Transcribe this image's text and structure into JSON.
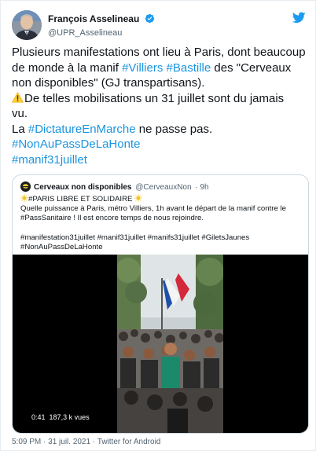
{
  "author": {
    "display_name": "François Asselineau",
    "handle": "@UPR_Asselineau"
  },
  "tweet": {
    "line1": "Plusieurs manifestations ont lieu à Paris, dont beaucoup",
    "line2_pre": "de monde à la manif ",
    "tag_villiers": "#Villiers",
    "tag_bastille": "#Bastille",
    "line2_post": " des \"Cerveaux",
    "line3": "non disponibles\" (GJ transpartisans).",
    "line4": "De telles mobilisations un 31 juillet sont du jamais",
    "line5": "vu.",
    "line6_pre": "La ",
    "tag_dictature": "#DictatureEnMarche",
    "line6_post": " ne passe pas.",
    "tag_nonaupass": "#NonAuPassDeLaHonte",
    "tag_manif": "#manif31juillet"
  },
  "quote": {
    "name": "Cerveaux non disponibles",
    "handle": "@CerveauxNon",
    "time": "· 9h",
    "title": "#PARIS LIBRE ET SOLIDAIRE",
    "line2": "Quelle puissance à Paris, métro Villiers, 1h avant le départ de la manif contre le",
    "line3": "#PassSanitaire ! Il est encore temps de nous rejoindre.",
    "line5": "#manifestation31juillet #manif31juillet #manifs31juillet #GiletsJaunes",
    "line6": "#NonAuPassDeLaHonte",
    "video_duration": "0:41",
    "video_views": "187,3 k vues"
  },
  "footer": {
    "text": "5:09 PM · 31 juil. 2021 · Twitter for Android"
  },
  "colors": {
    "link": "#1b95e0",
    "muted": "#536471",
    "border": "#cfd9de",
    "verified": "#1d9bf0",
    "twitter_blue": "#1d9bf0"
  },
  "icons": [
    "verified-badge-icon",
    "twitter-bird-icon",
    "warning-icon",
    "sun-icon"
  ]
}
